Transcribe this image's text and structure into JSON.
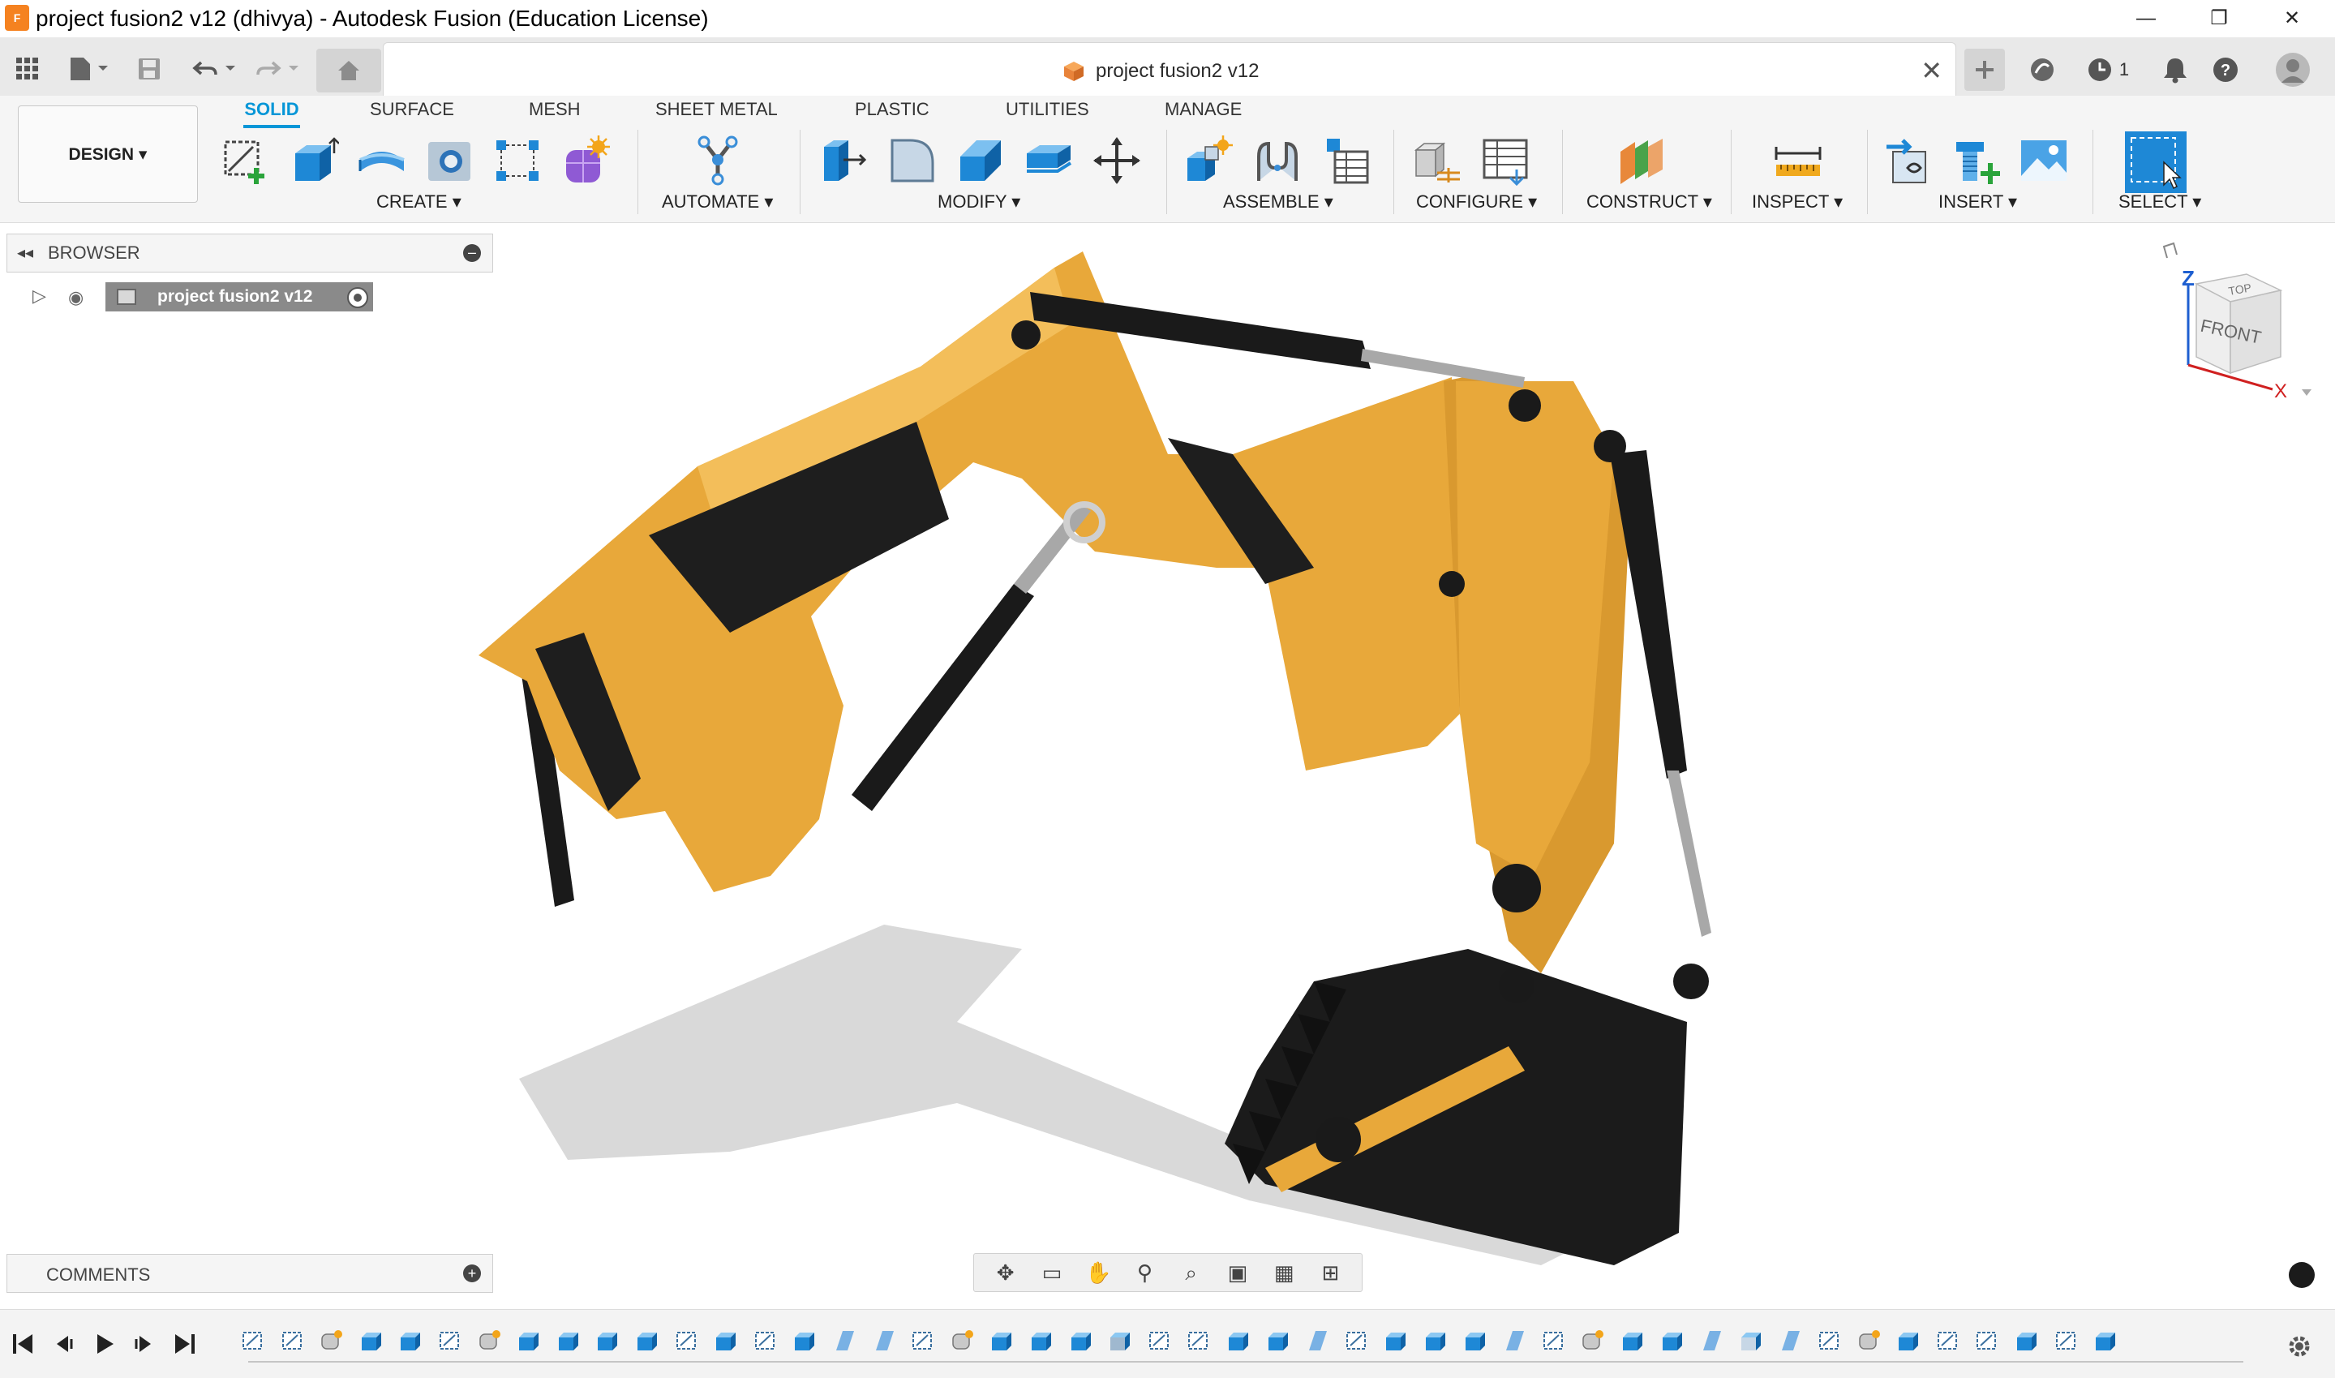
{
  "window": {
    "title": "project fusion2 v12 (dhivya) - Autodesk Fusion (Education License)",
    "logo_text": "F",
    "controls": [
      "minimize",
      "restore",
      "close"
    ]
  },
  "document_tab": {
    "label": "project fusion2 v12"
  },
  "status": {
    "job_count": "1"
  },
  "design_button": {
    "label": "DESIGN"
  },
  "ribbon_tabs": [
    "SOLID",
    "SURFACE",
    "MESH",
    "SHEET METAL",
    "PLASTIC",
    "UTILITIES",
    "MANAGE"
  ],
  "active_tab": "SOLID",
  "groups": {
    "create": "CREATE",
    "automate": "AUTOMATE",
    "modify": "MODIFY",
    "assemble": "ASSEMBLE",
    "configure": "CONFIGURE",
    "construct": "CONSTRUCT",
    "inspect": "INSPECT",
    "insert": "INSERT",
    "select": "SELECT"
  },
  "browser": {
    "title": "BROWSER",
    "root_node": "project fusion2 v12"
  },
  "comments": {
    "title": "COMMENTS"
  },
  "viewcube": {
    "top": "TOP",
    "front": "FRONT",
    "z": "Z",
    "x": "X"
  },
  "colors": {
    "accent": "#0696d7",
    "model_yellow": "#e8a83a",
    "model_black": "#1f1f1f",
    "logo": "#f58220"
  }
}
